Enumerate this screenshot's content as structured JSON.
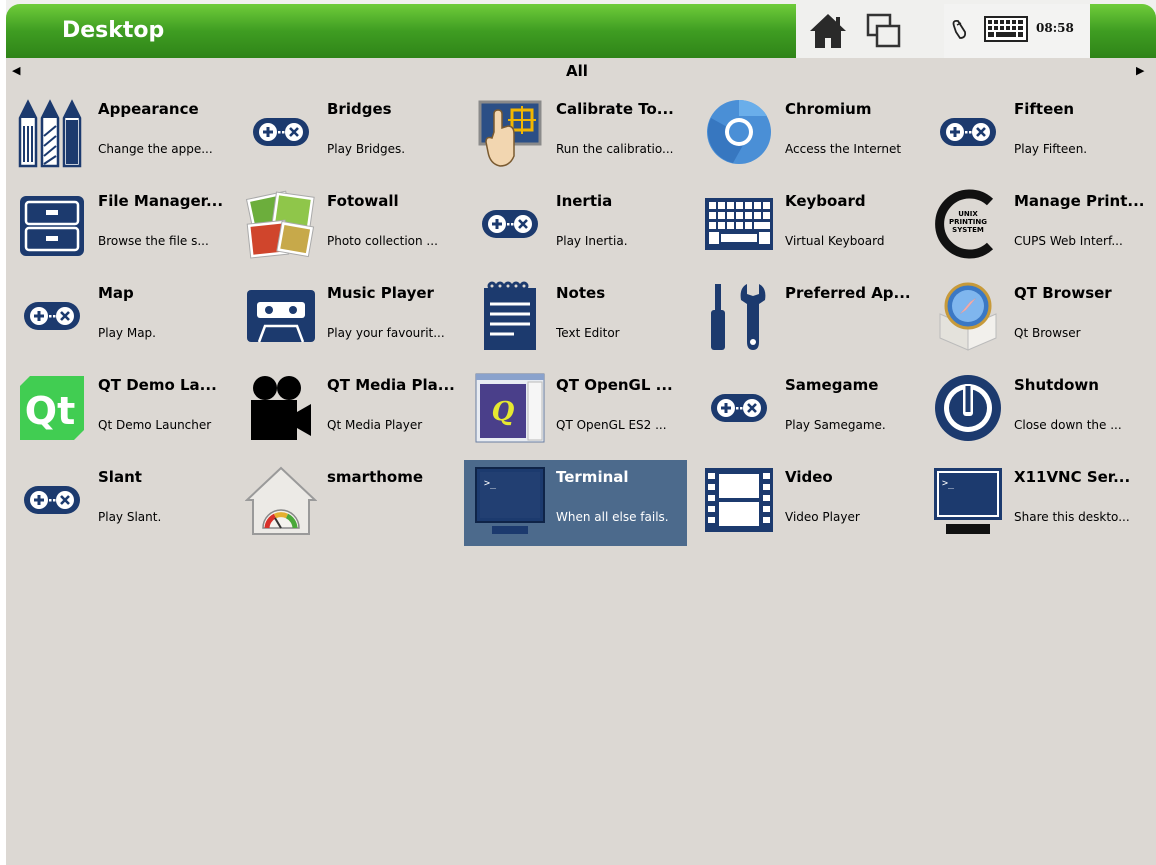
{
  "header": {
    "title": "Desktop",
    "clock": "08:58",
    "home_icon": "home-icon",
    "windows_icon": "window-switcher-icon",
    "mouse_icon": "mouse-icon",
    "keyboard_icon": "keyboard-icon"
  },
  "category": {
    "label": "All",
    "prev_icon": "arrow-left-icon",
    "next_icon": "arrow-right-icon"
  },
  "apps": [
    {
      "name": "Appearance",
      "desc": "Change the appe...",
      "icon": "pencils-icon"
    },
    {
      "name": "Bridges",
      "desc": "Play Bridges.",
      "icon": "gamepad-icon"
    },
    {
      "name": "Calibrate To...",
      "desc": "Run the calibratio...",
      "icon": "touch-calibrate-icon"
    },
    {
      "name": "Chromium",
      "desc": "Access the Internet",
      "icon": "chromium-icon"
    },
    {
      "name": "Fifteen",
      "desc": "Play Fifteen.",
      "icon": "gamepad-icon"
    },
    {
      "name": "File Manager...",
      "desc": "Browse the file s...",
      "icon": "file-cabinet-icon"
    },
    {
      "name": "Fotowall",
      "desc": "Photo collection ...",
      "icon": "photos-icon"
    },
    {
      "name": "Inertia",
      "desc": "Play Inertia.",
      "icon": "gamepad-icon"
    },
    {
      "name": "Keyboard",
      "desc": "Virtual Keyboard",
      "icon": "keyboard-icon"
    },
    {
      "name": "Manage Print...",
      "desc": "CUPS Web Interf...",
      "icon": "cups-icon"
    },
    {
      "name": "Map",
      "desc": "Play Map.",
      "icon": "gamepad-icon"
    },
    {
      "name": "Music Player",
      "desc": "Play your favourit...",
      "icon": "cassette-icon"
    },
    {
      "name": "Notes",
      "desc": "Text Editor",
      "icon": "notepad-icon"
    },
    {
      "name": "Preferred Ap...",
      "desc": "",
      "icon": "tools-icon"
    },
    {
      "name": "QT Browser",
      "desc": "Qt Browser",
      "icon": "safari-box-icon"
    },
    {
      "name": "QT Demo La...",
      "desc": "Qt Demo Launcher",
      "icon": "qt-logo-icon"
    },
    {
      "name": "QT Media Pla...",
      "desc": "Qt Media Player",
      "icon": "movie-camera-icon"
    },
    {
      "name": "QT OpenGL ...",
      "desc": "QT OpenGL ES2 ...",
      "icon": "opengl-window-icon"
    },
    {
      "name": "Samegame",
      "desc": "Play Samegame.",
      "icon": "gamepad-icon"
    },
    {
      "name": "Shutdown",
      "desc": "Close down the ...",
      "icon": "power-icon"
    },
    {
      "name": "Slant",
      "desc": "Play Slant.",
      "icon": "gamepad-icon"
    },
    {
      "name": "smarthome",
      "desc": "",
      "icon": "smart-home-icon"
    },
    {
      "name": "Terminal",
      "desc": "When all else fails.",
      "icon": "terminal-icon",
      "selected": true
    },
    {
      "name": "Video",
      "desc": "Video Player",
      "icon": "film-icon"
    },
    {
      "name": "X11VNC Ser...",
      "desc": "Share this deskto...",
      "icon": "monitor-terminal-icon"
    }
  ],
  "colors": {
    "header_green": "#3f9d22",
    "background": "#dcd8d3",
    "selection": "#4c6a8c",
    "icon_blue": "#1c3a6e"
  }
}
